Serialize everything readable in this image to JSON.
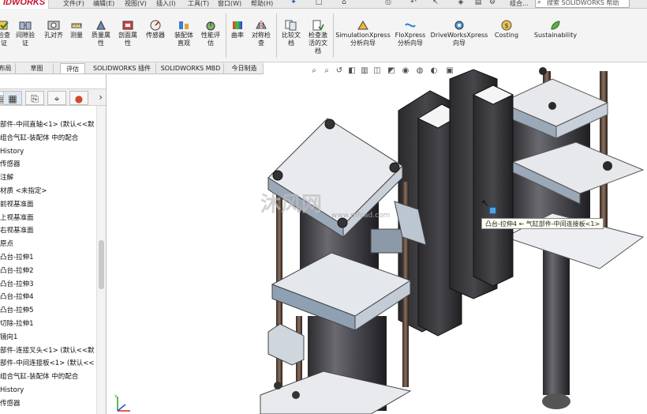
{
  "titlebar": {
    "logo": "IDWORKS",
    "menus": [
      "文件(F)",
      "编辑(E)",
      "视图(V)",
      "插入(I)",
      "工具(T)",
      "窗口(W)",
      "帮助(H)"
    ],
    "partial_label": "组合...",
    "search_placeholder": "搜索 SOLIDWORKS 帮助"
  },
  "ribbon": {
    "buttons": [
      {
        "label": "检查\n证",
        "icon": "check-icon"
      },
      {
        "label": "间隙验\n证",
        "icon": "clearance-icon"
      },
      {
        "label": "孔对齐",
        "icon": "hole-align-icon"
      },
      {
        "label": "测量",
        "icon": "measure-icon"
      },
      {
        "label": "质量属\n性",
        "icon": "mass-properties-icon"
      },
      {
        "label": "剖面属\n性",
        "icon": "section-properties-icon"
      },
      {
        "label": "传感器",
        "icon": "sensor-icon"
      },
      {
        "label": "装配体\n直观",
        "icon": "assembly-visualization-icon"
      },
      {
        "label": "性能评\n估",
        "icon": "performance-icon"
      },
      {
        "label": "曲率",
        "icon": "curvature-icon"
      },
      {
        "label": "对称检\n查",
        "icon": "symmetry-check-icon"
      },
      {
        "label": "比较文\n档",
        "icon": "compare-icon"
      },
      {
        "label": "检查激\n活的文\n档",
        "icon": "check-active-icon"
      },
      {
        "label": "SimulationXpress\n分析向导",
        "icon": "simulationxpress-icon"
      },
      {
        "label": "FloXpress\n分析向导",
        "icon": "floxpress-icon"
      },
      {
        "label": "DriveWorksXpress\n向导",
        "icon": "driveworks-icon"
      },
      {
        "label": "Costing",
        "icon": "costing-icon"
      },
      {
        "label": "Sustainability",
        "icon": "sustainability-icon"
      }
    ]
  },
  "tabs": [
    {
      "label": "布局",
      "active": false
    },
    {
      "label": "草图",
      "active": false
    },
    {
      "label": "评估",
      "active": true
    },
    {
      "label": "SOLIDWORKS 插件",
      "active": false
    },
    {
      "label": "SOLIDWORKS MBD",
      "active": false
    },
    {
      "label": "今日制造",
      "active": false
    }
  ],
  "feature_tree": {
    "items": [
      "部件-中间直轴<1> (默认<<默",
      "组合气缸-装配体 中的配合",
      "History",
      "传感器",
      "注解",
      "材质 <未指定>",
      "前视基准面",
      "上视基准面",
      "右视基准面",
      "原点",
      "凸台-拉伸1",
      "凸台-拉伸2",
      "凸台-拉伸3",
      "凸台-拉伸4",
      "凸台-拉伸5",
      "切除-拉伸1",
      "镜向1",
      "部件-连接叉头<1> (默认<<默",
      "部件-中间连接板<1> (默认<<",
      "组合气缸-装配体 中的配合",
      "History",
      "传感器"
    ]
  },
  "viewport": {
    "tooltip": "凸台-拉伸4 ← 气缸部件-中间连接板<1>",
    "watermark": "沐风网",
    "watermark_url": "www.mfcad.com"
  },
  "colors": {
    "accent_red": "#c8102e",
    "steel_light": "#e4e6ea",
    "steel_dark": "#3c3c40",
    "tooltip_bg": "#fffff4"
  }
}
